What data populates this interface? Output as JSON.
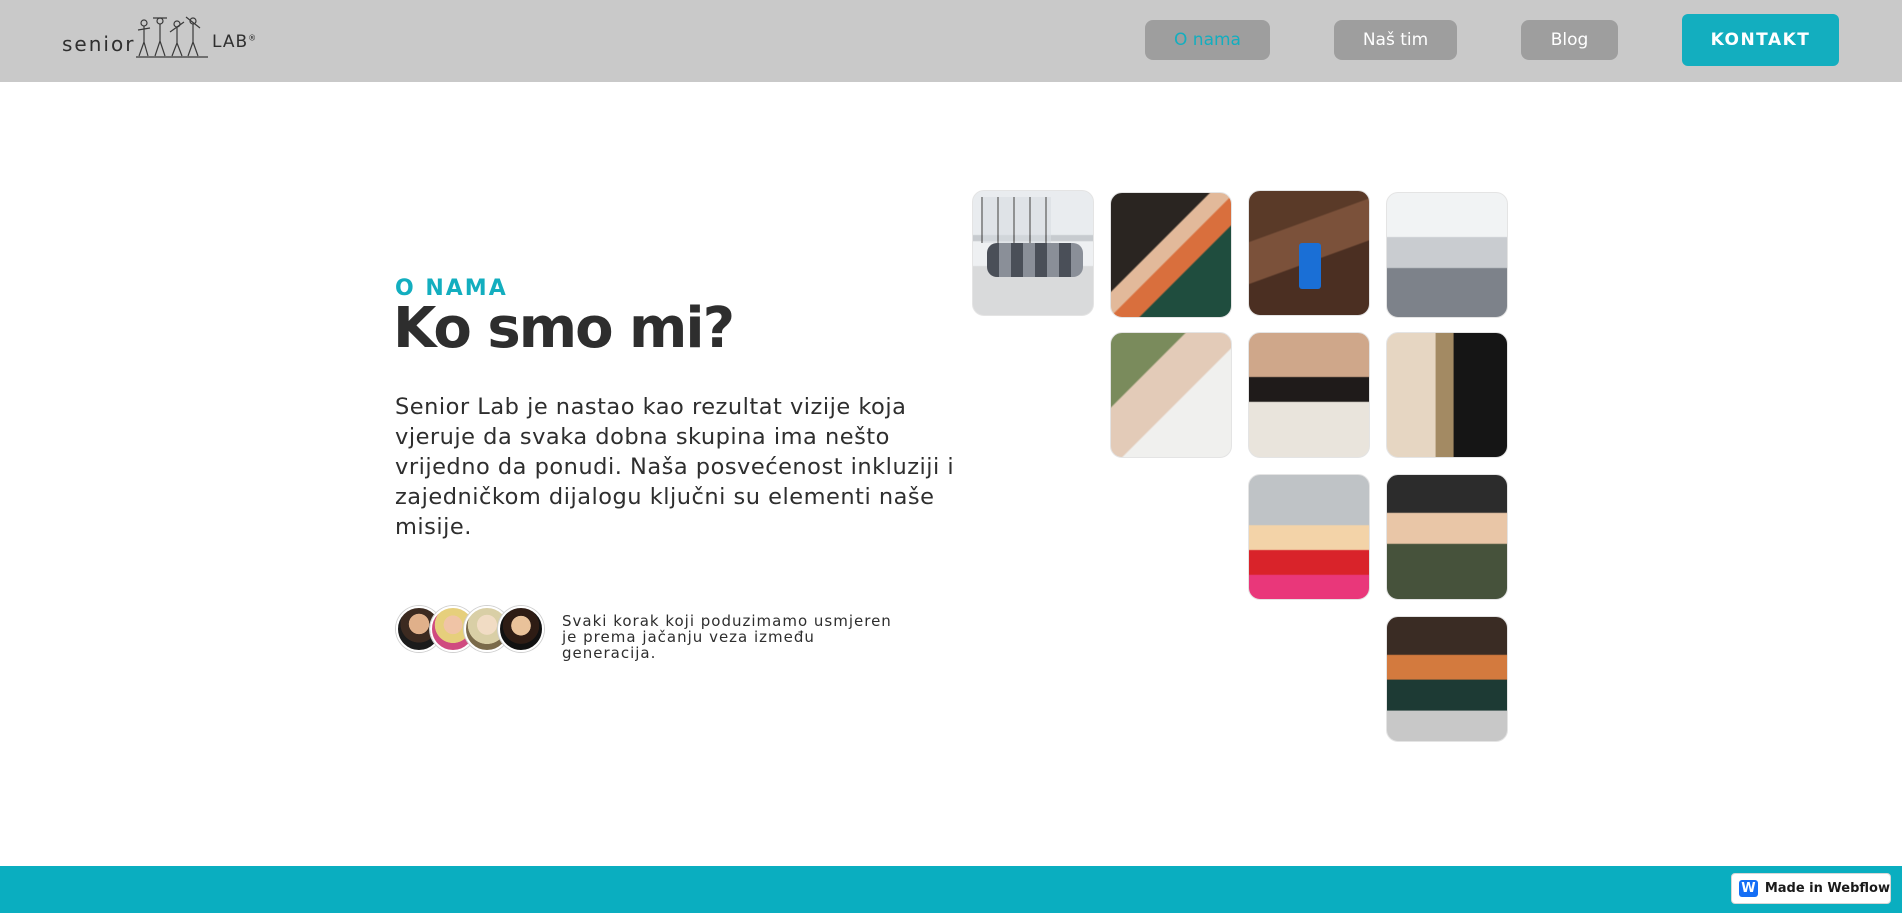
{
  "header": {
    "logo": {
      "word_1": "senior",
      "word_2": "LAB",
      "mark": "®"
    },
    "nav": [
      {
        "label": "O nama",
        "active": true
      },
      {
        "label": "Naš tim",
        "active": false
      },
      {
        "label": "Blog",
        "active": false
      }
    ],
    "cta_label": "KONTAKT"
  },
  "hero": {
    "eyebrow": "O NAMA",
    "title": "Ko smo mi?",
    "description": "Senior Lab je nastao kao rezultat vizije koja vjeruje da svaka dobna skupina ima nešto vrijedno da ponudi. Naša posvećenost inkluziji i zajedničkom dijalogu ključni su elementi naše misije.",
    "tagline": "Svaki korak koji poduzimamo usmjeren je prema jačanju veza između generacija."
  },
  "footer": {
    "badge_label": "Made in Webflow",
    "badge_icon": "W"
  },
  "colors": {
    "accent": "#13aebf",
    "header_bg": "#c9c9c9",
    "nav_bg": "#9e9e9e",
    "text": "#2e2e2e",
    "footer_bar": "#0aaec0",
    "webflow_blue": "#146ef5"
  }
}
